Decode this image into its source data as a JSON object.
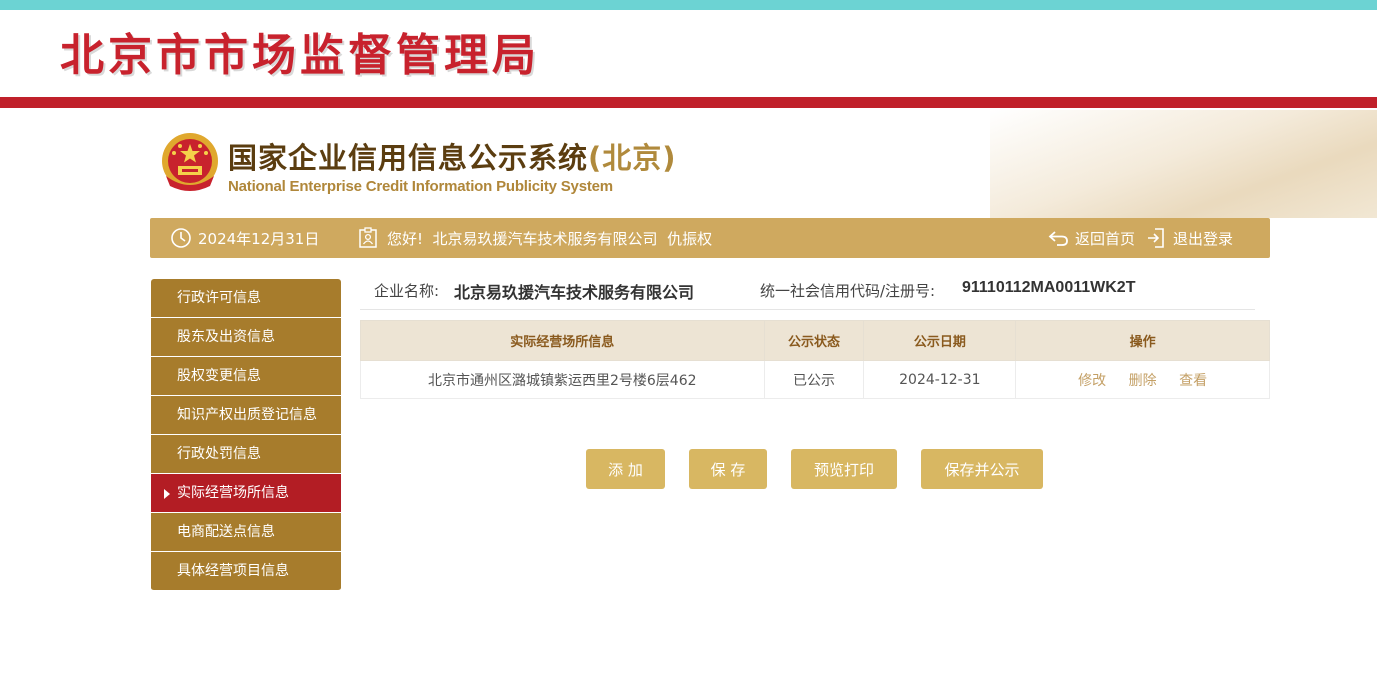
{
  "header": {
    "bureau_title": "北京市市场监督管理局",
    "system_title_cn": "国家企业信用信息公示系统",
    "system_title_region": "(北京)",
    "system_title_en": "National Enterprise Credit Information Publicity System"
  },
  "info_bar": {
    "date": "2024年12月31日",
    "greeting": "您好!  北京易玖援汽车技术服务有限公司  仇振权",
    "home_label": "返回首页",
    "logout_label": "退出登录"
  },
  "sidebar": {
    "items": [
      {
        "label": "行政许可信息",
        "active": false
      },
      {
        "label": "股东及出资信息",
        "active": false
      },
      {
        "label": "股权变更信息",
        "active": false
      },
      {
        "label": "知识产权出质登记信息",
        "active": false
      },
      {
        "label": "行政处罚信息",
        "active": false
      },
      {
        "label": "实际经营场所信息",
        "active": true
      },
      {
        "label": "电商配送点信息",
        "active": false
      },
      {
        "label": "具体经营项目信息",
        "active": false
      }
    ]
  },
  "company": {
    "name_label": "企业名称:",
    "name": "北京易玖援汽车技术服务有限公司",
    "code_label": "统一社会信用代码/注册号:",
    "code": "91110112MA0011WK2T"
  },
  "table": {
    "headers": [
      "实际经营场所信息",
      "公示状态",
      "公示日期",
      "操作"
    ],
    "rows": [
      {
        "address": "北京市通州区潞城镇紫运西里2号楼6层462",
        "status": "已公示",
        "date": "2024-12-31",
        "ops": [
          "修改",
          "删除",
          "查看"
        ]
      }
    ]
  },
  "buttons": {
    "add": "添 加",
    "save": "保 存",
    "preview_print": "预览打印",
    "save_publish": "保存并公示"
  },
  "colors": {
    "brand_red": "#c0202a",
    "gold_bar": "#cfa95f",
    "sidebar_brown": "#a77c2c",
    "sidebar_active": "#b31d24",
    "button_gold": "#d8b762"
  }
}
